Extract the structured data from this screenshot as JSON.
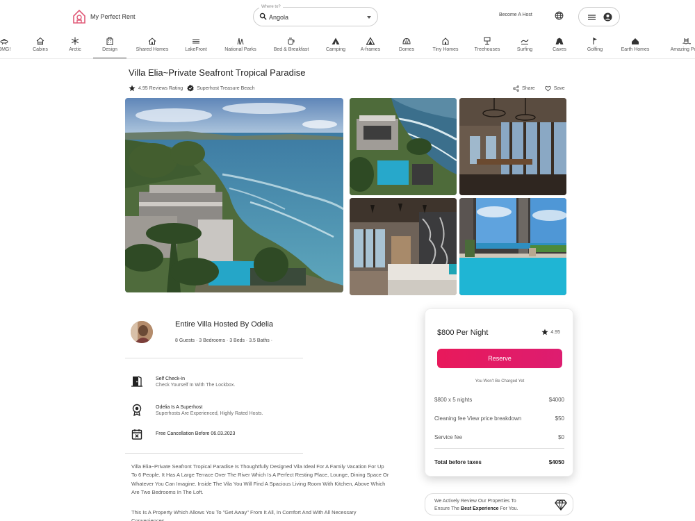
{
  "brand": {
    "name": "My Perfect Rent"
  },
  "search": {
    "label": "Where to?",
    "value": "Angola"
  },
  "header": {
    "become_host": "Become A Host"
  },
  "categories": [
    {
      "label": "OMG!",
      "icon": "ufo-icon"
    },
    {
      "label": "Cabins",
      "icon": "cabin-icon"
    },
    {
      "label": "Arctic",
      "icon": "snowflake-icon"
    },
    {
      "label": "Design",
      "icon": "building-icon"
    },
    {
      "label": "Shared Homes",
      "icon": "shared-home-icon"
    },
    {
      "label": "LakeFront",
      "icon": "lake-icon"
    },
    {
      "label": "National Parks",
      "icon": "park-icon"
    },
    {
      "label": "Bed & Breakfast",
      "icon": "coffee-icon"
    },
    {
      "label": "Camping",
      "icon": "tent-icon"
    },
    {
      "label": "A-frames",
      "icon": "a-frame-icon"
    },
    {
      "label": "Domes",
      "icon": "dome-icon"
    },
    {
      "label": "Tiny Homes",
      "icon": "tiny-home-icon"
    },
    {
      "label": "Treehouses",
      "icon": "treehouse-icon"
    },
    {
      "label": "Surfing",
      "icon": "surfing-icon"
    },
    {
      "label": "Caves",
      "icon": "cave-icon"
    },
    {
      "label": "Golfing",
      "icon": "golf-flag-icon"
    },
    {
      "label": "Earth Homes",
      "icon": "earth-home-icon"
    },
    {
      "label": "Amazing Pools",
      "icon": "pool-icon"
    }
  ],
  "listing": {
    "title": "Villa Elia~Private Seafront Tropical Paradise",
    "rating_text": "4.95 Reviews Rating",
    "superhost_text": "Superhost Treasure Beach",
    "share": "Share",
    "save": "Save"
  },
  "host": {
    "title": "Entire Villa Hosted By Odelia",
    "details": "8 Guests · 3 Bedrooms · 3 Beds · 3.5 Baths ·"
  },
  "features": [
    {
      "title": "Self Check-In",
      "sub": "Check Yourself In With The Lockbox.",
      "icon": "door-icon"
    },
    {
      "title": "Odelia Is A Superhost",
      "sub": "Superhosts Are Experienced, Highly Rated Hosts.",
      "icon": "medal-icon"
    },
    {
      "title": "Free Cancellation Before 06.03.2023",
      "sub": "",
      "icon": "calendar-x-icon"
    }
  ],
  "description": [
    "Villa Elia~Private Seafront Tropical Paradise Is Thoughtfully Designed Vila Ideal For A Family Vacation For Up To 6 People. It Has A Large Terrace Over The River Which Is A Perfect Resting Place, Lounge, Dining Space Or Whatever You Can Imagine. Inside The Vila You Will Find A Spacious Living Room With Kitchen, Above Which Are Two Bedrooms In The Loft.",
    "This Is A Property Which Allows You To \"Get Away\" From It All, In Comfort And With All Necessary Conveniences."
  ],
  "booking": {
    "price": "$800 Per Night",
    "rating": "4.95",
    "reserve": "Reserve",
    "note": "You Won't Be Charged Yet",
    "lines": [
      {
        "label": "$800 x 5 nights",
        "value": "$4000"
      },
      {
        "label": "Cleaning fee View price breakdown",
        "value": "$50"
      },
      {
        "label": "Service fee",
        "value": "$0"
      }
    ],
    "total_label": "Total before taxes",
    "total_value": "$4050"
  },
  "banner": {
    "line1": "We Actively Review Our Properties To",
    "line2_pre": "Ensure The ",
    "line2_bold": "Best Experience",
    "line2_post": " For You."
  },
  "colors": {
    "accent": "#e8195b",
    "brand": "#e05a78"
  }
}
